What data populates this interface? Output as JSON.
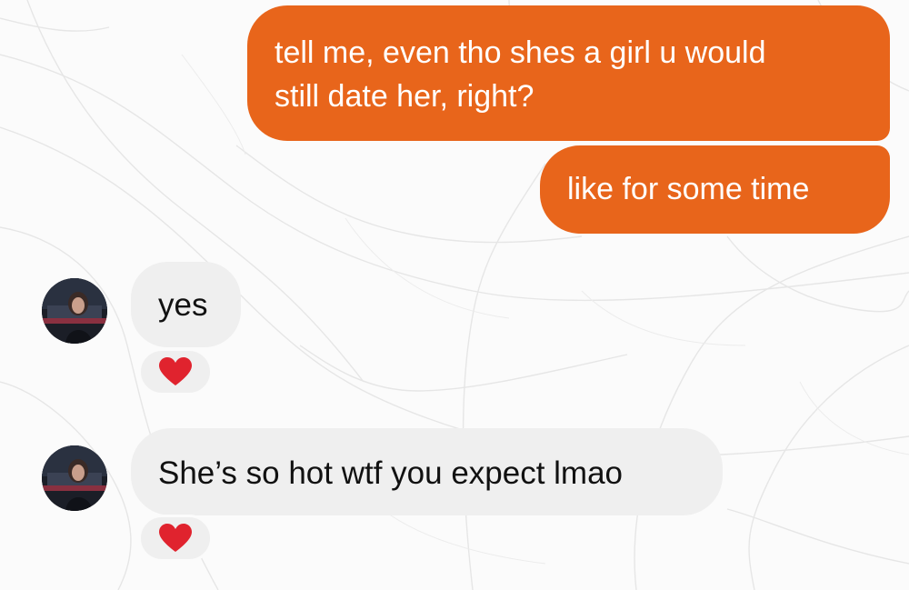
{
  "colors": {
    "sent_bubble": "#e8651b",
    "sent_text": "#ffffff",
    "received_bubble": "#efefef",
    "received_text": "#111111",
    "reaction_heart": "#e0232e",
    "background": "#fbfbfb"
  },
  "messages": [
    {
      "direction": "sent",
      "lines": [
        "tell me, even tho shes a girl u would",
        "still date her, right?"
      ]
    },
    {
      "direction": "sent",
      "lines": [
        "like for some time"
      ]
    },
    {
      "direction": "received",
      "lines": [
        "yes"
      ],
      "reaction": "red-heart-icon"
    },
    {
      "direction": "received",
      "lines": [
        "She’s so hot wtf you expect lmao"
      ],
      "reaction": "red-heart-icon"
    }
  ]
}
